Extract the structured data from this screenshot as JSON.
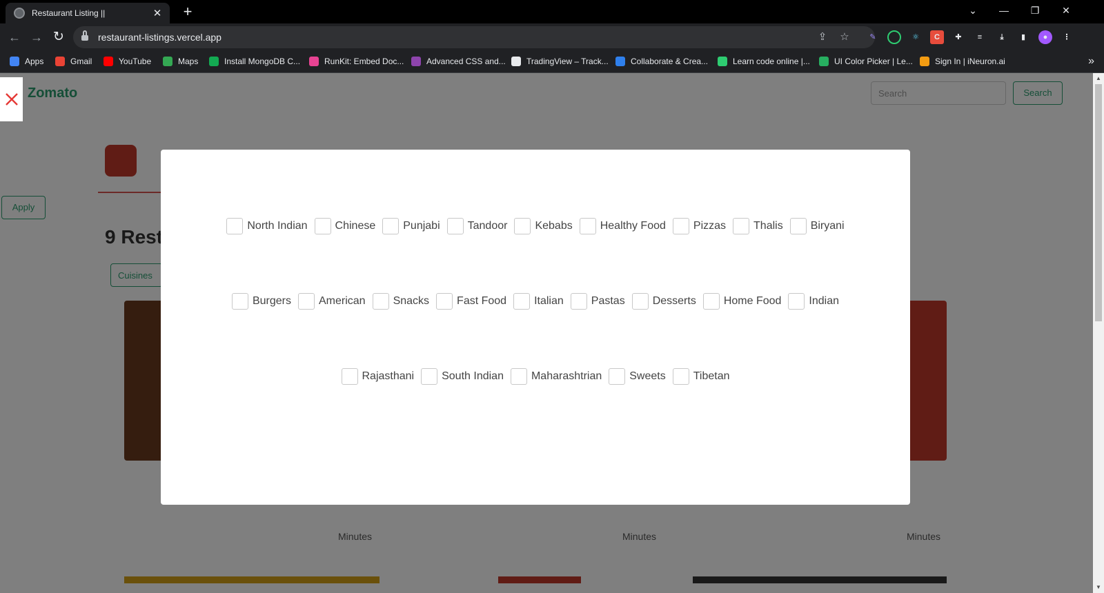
{
  "browser": {
    "tab_title": "Restaurant Listing ||",
    "new_tab": "+",
    "url": "restaurant-listings.vercel.app"
  },
  "bookmarks": [
    {
      "label": "Apps",
      "color": "#4285f4"
    },
    {
      "label": "Gmail",
      "color": "#ea4335"
    },
    {
      "label": "YouTube",
      "color": "#ff0000"
    },
    {
      "label": "Maps",
      "color": "#34a853"
    },
    {
      "label": "Install MongoDB C...",
      "color": "#13aa52"
    },
    {
      "label": "RunKit: Embed Doc...",
      "color": "#e84393"
    },
    {
      "label": "Advanced CSS and...",
      "color": "#8e44ad"
    },
    {
      "label": "TradingView – Track...",
      "color": "#e8eaed"
    },
    {
      "label": "Collaborate & Crea...",
      "color": "#2f80ed"
    },
    {
      "label": "Learn code online |...",
      "color": "#2ecc71"
    },
    {
      "label": "UI Color Picker | Le...",
      "color": "#27ae60"
    },
    {
      "label": "Sign In | iNeuron.ai",
      "color": "#f39c12"
    }
  ],
  "page": {
    "brand": "Zomato",
    "search_placeholder": "Search",
    "search_button": "Search",
    "apply_button": "Apply",
    "restaurant_count": "9 Rest",
    "filter_button": "Cuisines",
    "minutes_label": "Minutes"
  },
  "modal": {
    "rows": [
      [
        "North Indian",
        "Chinese",
        "Punjabi",
        "Tandoor",
        "Kebabs",
        "Healthy Food",
        "Pizzas",
        "Thalis",
        "Biryani"
      ],
      [
        "Burgers",
        "American",
        "Snacks",
        "Fast Food",
        "Italian",
        "Pastas",
        "Desserts",
        "Home Food",
        "Indian"
      ],
      [
        "Rajasthani",
        "South Indian",
        "Maharashtrian",
        "Sweets",
        "Tibetan"
      ]
    ]
  },
  "colors": {
    "accent_green": "#2a9d6f",
    "close_red": "#e53935"
  }
}
